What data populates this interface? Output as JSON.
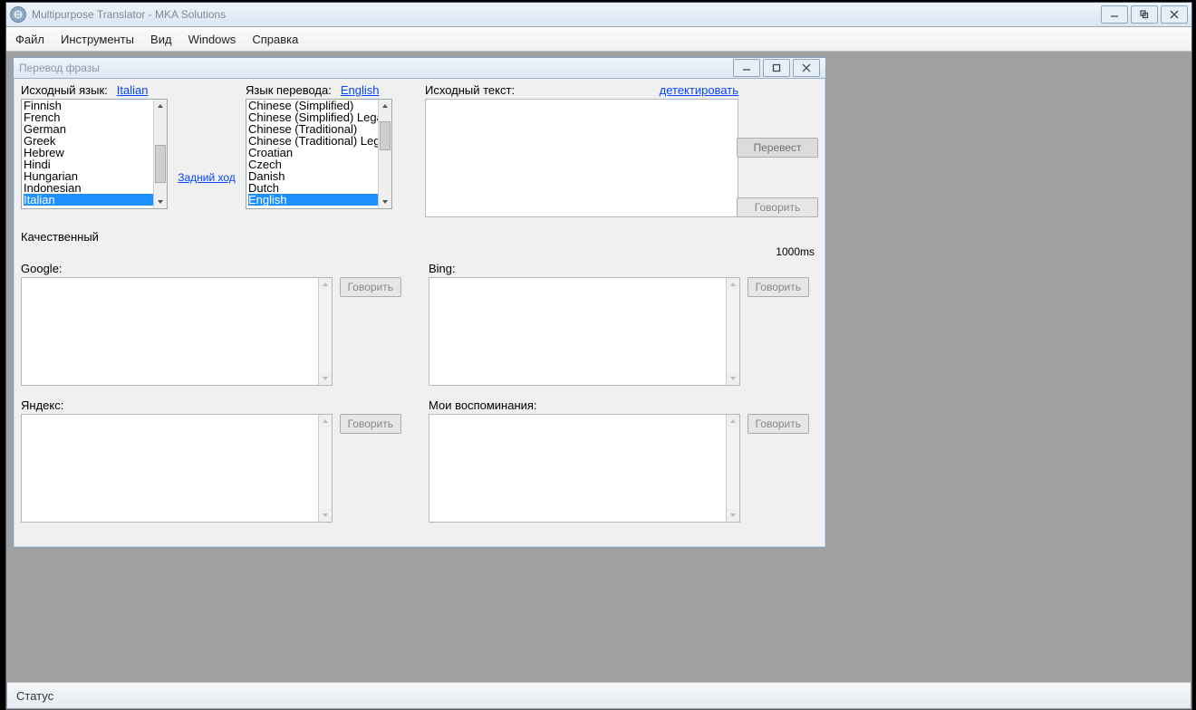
{
  "app": {
    "title": "Multipurpose Translator - MKA Solutions"
  },
  "menu": [
    "Файл",
    "Инструменты",
    "Вид",
    "Windows",
    "Справка"
  ],
  "child": {
    "title": "Перевод фразы",
    "source_label": "Исходный язык:",
    "source_selected": "Italian",
    "target_label": "Язык перевода:",
    "target_selected": "English",
    "reverse": "Задний ход",
    "source_text_label": "Исходный текст:",
    "detect": "детектировать",
    "translate_btn": "Перевест",
    "speak_btn": "Говорить",
    "quality": "Качественный",
    "timing": "1000ms",
    "source_items": [
      "Finnish",
      "French",
      "German",
      "Greek",
      "Hebrew",
      "Hindi",
      "Hungarian",
      "Indonesian",
      "Italian"
    ],
    "target_items": [
      "Chinese (Simplified)",
      "Chinese (Simplified) Legacy",
      "Chinese (Traditional)",
      "Chinese (Traditional) Legacy",
      "Croatian",
      "Czech",
      "Danish",
      "Dutch",
      "English"
    ],
    "results": [
      {
        "label": "Google:"
      },
      {
        "label": "Bing:"
      },
      {
        "label": "Яндекс:"
      },
      {
        "label": "Мои воспоминания:"
      }
    ]
  },
  "status": "Статус"
}
